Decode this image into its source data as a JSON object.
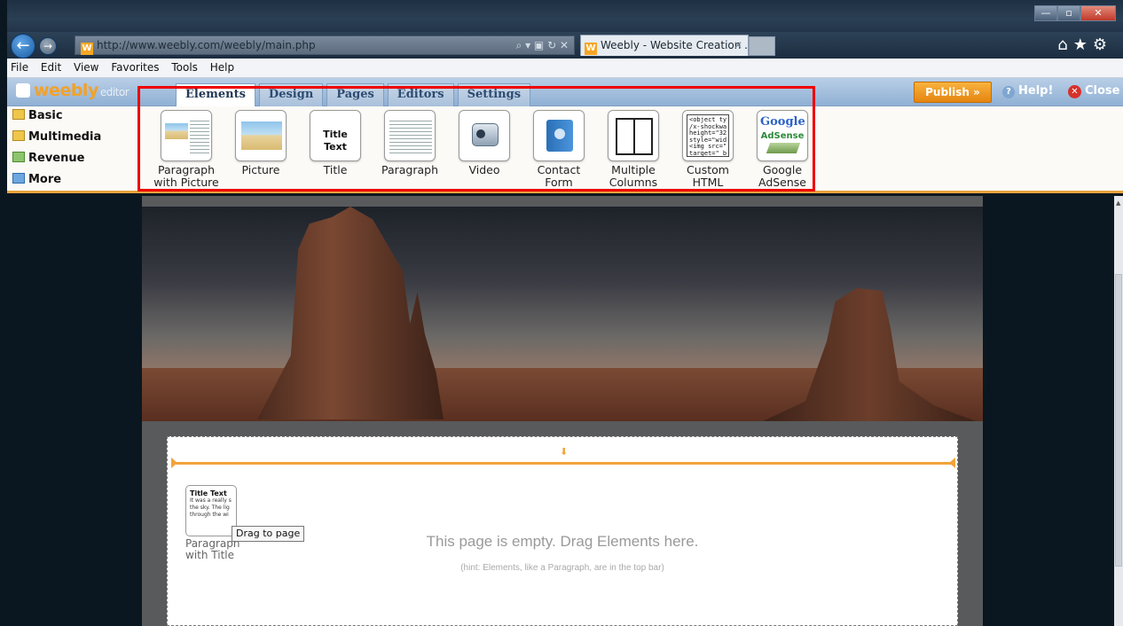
{
  "browser": {
    "address": "http://www.weebly.com/weebly/main.php",
    "tab_title": "Weebly - Website Creation ...",
    "window_controls": [
      "minimize-icon",
      "maximize-icon",
      "close-icon"
    ],
    "chrome_icons": [
      "home-icon",
      "favorites-star-icon",
      "settings-gear-icon"
    ]
  },
  "menubar": [
    "File",
    "Edit",
    "View",
    "Favorites",
    "Tools",
    "Help"
  ],
  "editor": {
    "logo": "weebly",
    "logo_suffix": "editor",
    "tabs": [
      "Elements",
      "Design",
      "Pages",
      "Editors",
      "Settings"
    ],
    "active_tab": "Elements",
    "publish_label": "Publish »",
    "help_label": "Help!",
    "close_label": "Close"
  },
  "categories": [
    "Basic",
    "Multimedia",
    "Revenue",
    "More"
  ],
  "elements": [
    {
      "label": "Paragraph with Picture",
      "icon": "paragraph-with-picture-icon"
    },
    {
      "label": "Picture",
      "icon": "picture-icon"
    },
    {
      "label": "Title",
      "icon": "title-icon",
      "thumb_text": "Title Text"
    },
    {
      "label": "Paragraph",
      "icon": "paragraph-icon"
    },
    {
      "label": "Video",
      "icon": "video-camera-icon"
    },
    {
      "label": "Contact Form",
      "icon": "contact-form-icon"
    },
    {
      "label": "Multiple Columns",
      "icon": "multiple-columns-icon"
    },
    {
      "label": "Custom HTML",
      "icon": "custom-html-icon",
      "thumb_text": "<object ty\n/x-shockwa\nheight=\"32\nstyle=\"wid\n<img src=\"\ntarget=\"_b"
    },
    {
      "label": "Google AdSense",
      "icon": "google-adsense-icon",
      "thumb_text": "Google",
      "thumb_sub": "AdSense"
    }
  ],
  "canvas": {
    "drag_card_title": "Title Text",
    "drag_card_body": "It was a really s the sky. The lig through the wi",
    "drag_card_caption": "Paragraph with Title",
    "tooltip": "Drag to page",
    "empty_message": "This page is empty. Drag Elements here.",
    "hint": "(hint: Elements, like a Paragraph, are in the top bar)"
  },
  "colors": {
    "accent": "#f2a33a",
    "highlight": "#e00000",
    "brand": "#f2a12a"
  }
}
